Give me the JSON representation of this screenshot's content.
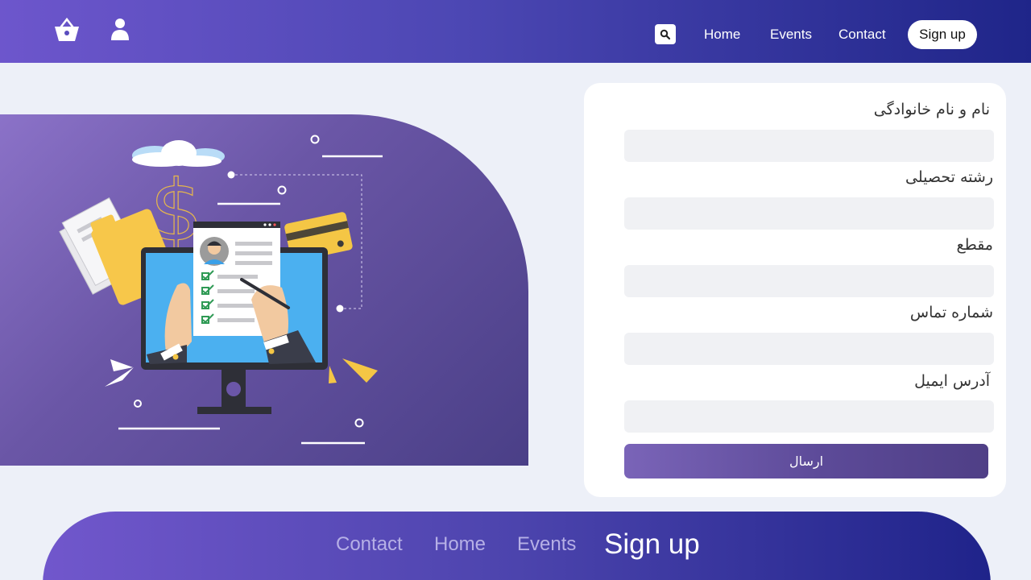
{
  "header": {
    "icons": {
      "basket": "basket-icon",
      "user": "user-icon",
      "search": "search-icon"
    },
    "nav": {
      "home": "Home",
      "events": "Events",
      "contact": "Contact"
    },
    "signup": "Sign up"
  },
  "form": {
    "fields": [
      {
        "label": "نام و نام خانوادگی",
        "value": ""
      },
      {
        "label": "رشته تحصیلی",
        "value": ""
      },
      {
        "label": "مقطع",
        "value": ""
      },
      {
        "label": "شماره تماس",
        "value": ""
      },
      {
        "label": "آدرس ایمیل",
        "value": ""
      }
    ],
    "submit": "ارسال"
  },
  "footer": {
    "nav": {
      "contact": "Contact",
      "home": "Home",
      "events": "Events",
      "signup": "Sign up"
    }
  },
  "colors": {
    "header_start": "#6d56cc",
    "header_end": "#1f2589",
    "background": "#edf0f8",
    "hero_start": "#8b72c8",
    "hero_end": "#4a3f87",
    "button_start": "#7a64b8",
    "button_end": "#4f3f86",
    "accent_yellow": "#fcc846",
    "screen_blue": "#4bb0f0"
  }
}
